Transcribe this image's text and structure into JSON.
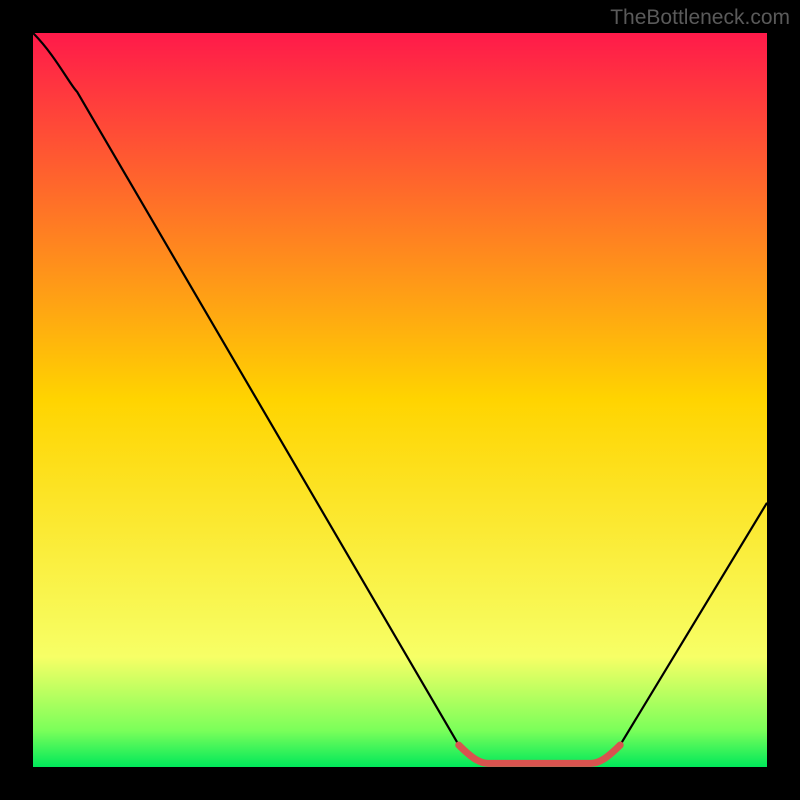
{
  "watermark": "TheBottleneck.com",
  "chart_data": {
    "type": "line",
    "title": "",
    "xlabel": "",
    "ylabel": "",
    "xlim": [
      0,
      100
    ],
    "ylim": [
      0,
      100
    ],
    "gradient_stops": [
      {
        "offset": 0,
        "color": "#ff1a4a"
      },
      {
        "offset": 50,
        "color": "#ffd400"
      },
      {
        "offset": 85,
        "color": "#f7ff66"
      },
      {
        "offset": 95,
        "color": "#7bff5a"
      },
      {
        "offset": 100,
        "color": "#00e85a"
      }
    ],
    "series": [
      {
        "name": "bottleneck-curve",
        "color": "#000000",
        "points": [
          {
            "x": 0,
            "y": 100
          },
          {
            "x": 6,
            "y": 92
          },
          {
            "x": 58,
            "y": 3
          },
          {
            "x": 62,
            "y": 0.5
          },
          {
            "x": 76,
            "y": 0.5
          },
          {
            "x": 80,
            "y": 3
          },
          {
            "x": 100,
            "y": 36
          }
        ]
      }
    ],
    "highlight_segment": {
      "color": "#d9534f",
      "points": [
        {
          "x": 58,
          "y": 3
        },
        {
          "x": 62,
          "y": 0.5
        },
        {
          "x": 76,
          "y": 0.5
        },
        {
          "x": 80,
          "y": 3
        }
      ]
    }
  }
}
